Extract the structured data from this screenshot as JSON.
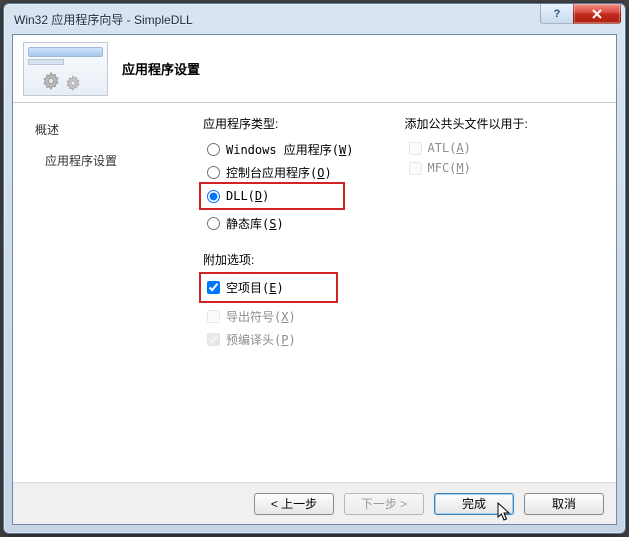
{
  "window": {
    "title": "Win32 应用程序向导 - SimpleDLL",
    "help": "?",
    "close": "×"
  },
  "header": {
    "title": "应用程序设置"
  },
  "sidebar": {
    "items": [
      {
        "label": "概述"
      },
      {
        "label": "应用程序设置"
      }
    ]
  },
  "app_type": {
    "legend": "应用程序类型:",
    "options": {
      "windows": {
        "text": "Windows 应用程序(",
        "mnemonic": "W",
        "tail": ")"
      },
      "console": {
        "text": "控制台应用程序(",
        "mnemonic": "O",
        "tail": ")"
      },
      "dll": {
        "text": "DLL(",
        "mnemonic": "D",
        "tail": ")"
      },
      "static": {
        "text": "静态库(",
        "mnemonic": "S",
        "tail": ")"
      }
    },
    "selected": "dll"
  },
  "additional": {
    "legend": "附加选项:",
    "options": {
      "empty": {
        "text": "空项目(",
        "mnemonic": "E",
        "tail": ")",
        "checked": true,
        "enabled": true
      },
      "export": {
        "text": "导出符号(",
        "mnemonic": "X",
        "tail": ")",
        "checked": false,
        "enabled": false
      },
      "precomp": {
        "text": "预编译头(",
        "mnemonic": "P",
        "tail": ")",
        "checked": true,
        "enabled": false
      }
    }
  },
  "common_headers": {
    "legend": "添加公共头文件以用于:",
    "options": {
      "atl": {
        "text": "ATL(",
        "mnemonic": "A",
        "tail": ")",
        "checked": false,
        "enabled": false
      },
      "mfc": {
        "text": "MFC(",
        "mnemonic": "M",
        "tail": ")",
        "checked": false,
        "enabled": false
      }
    }
  },
  "buttons": {
    "back": "< 上一步",
    "next": "下一步 >",
    "finish": "完成",
    "cancel": "取消"
  }
}
